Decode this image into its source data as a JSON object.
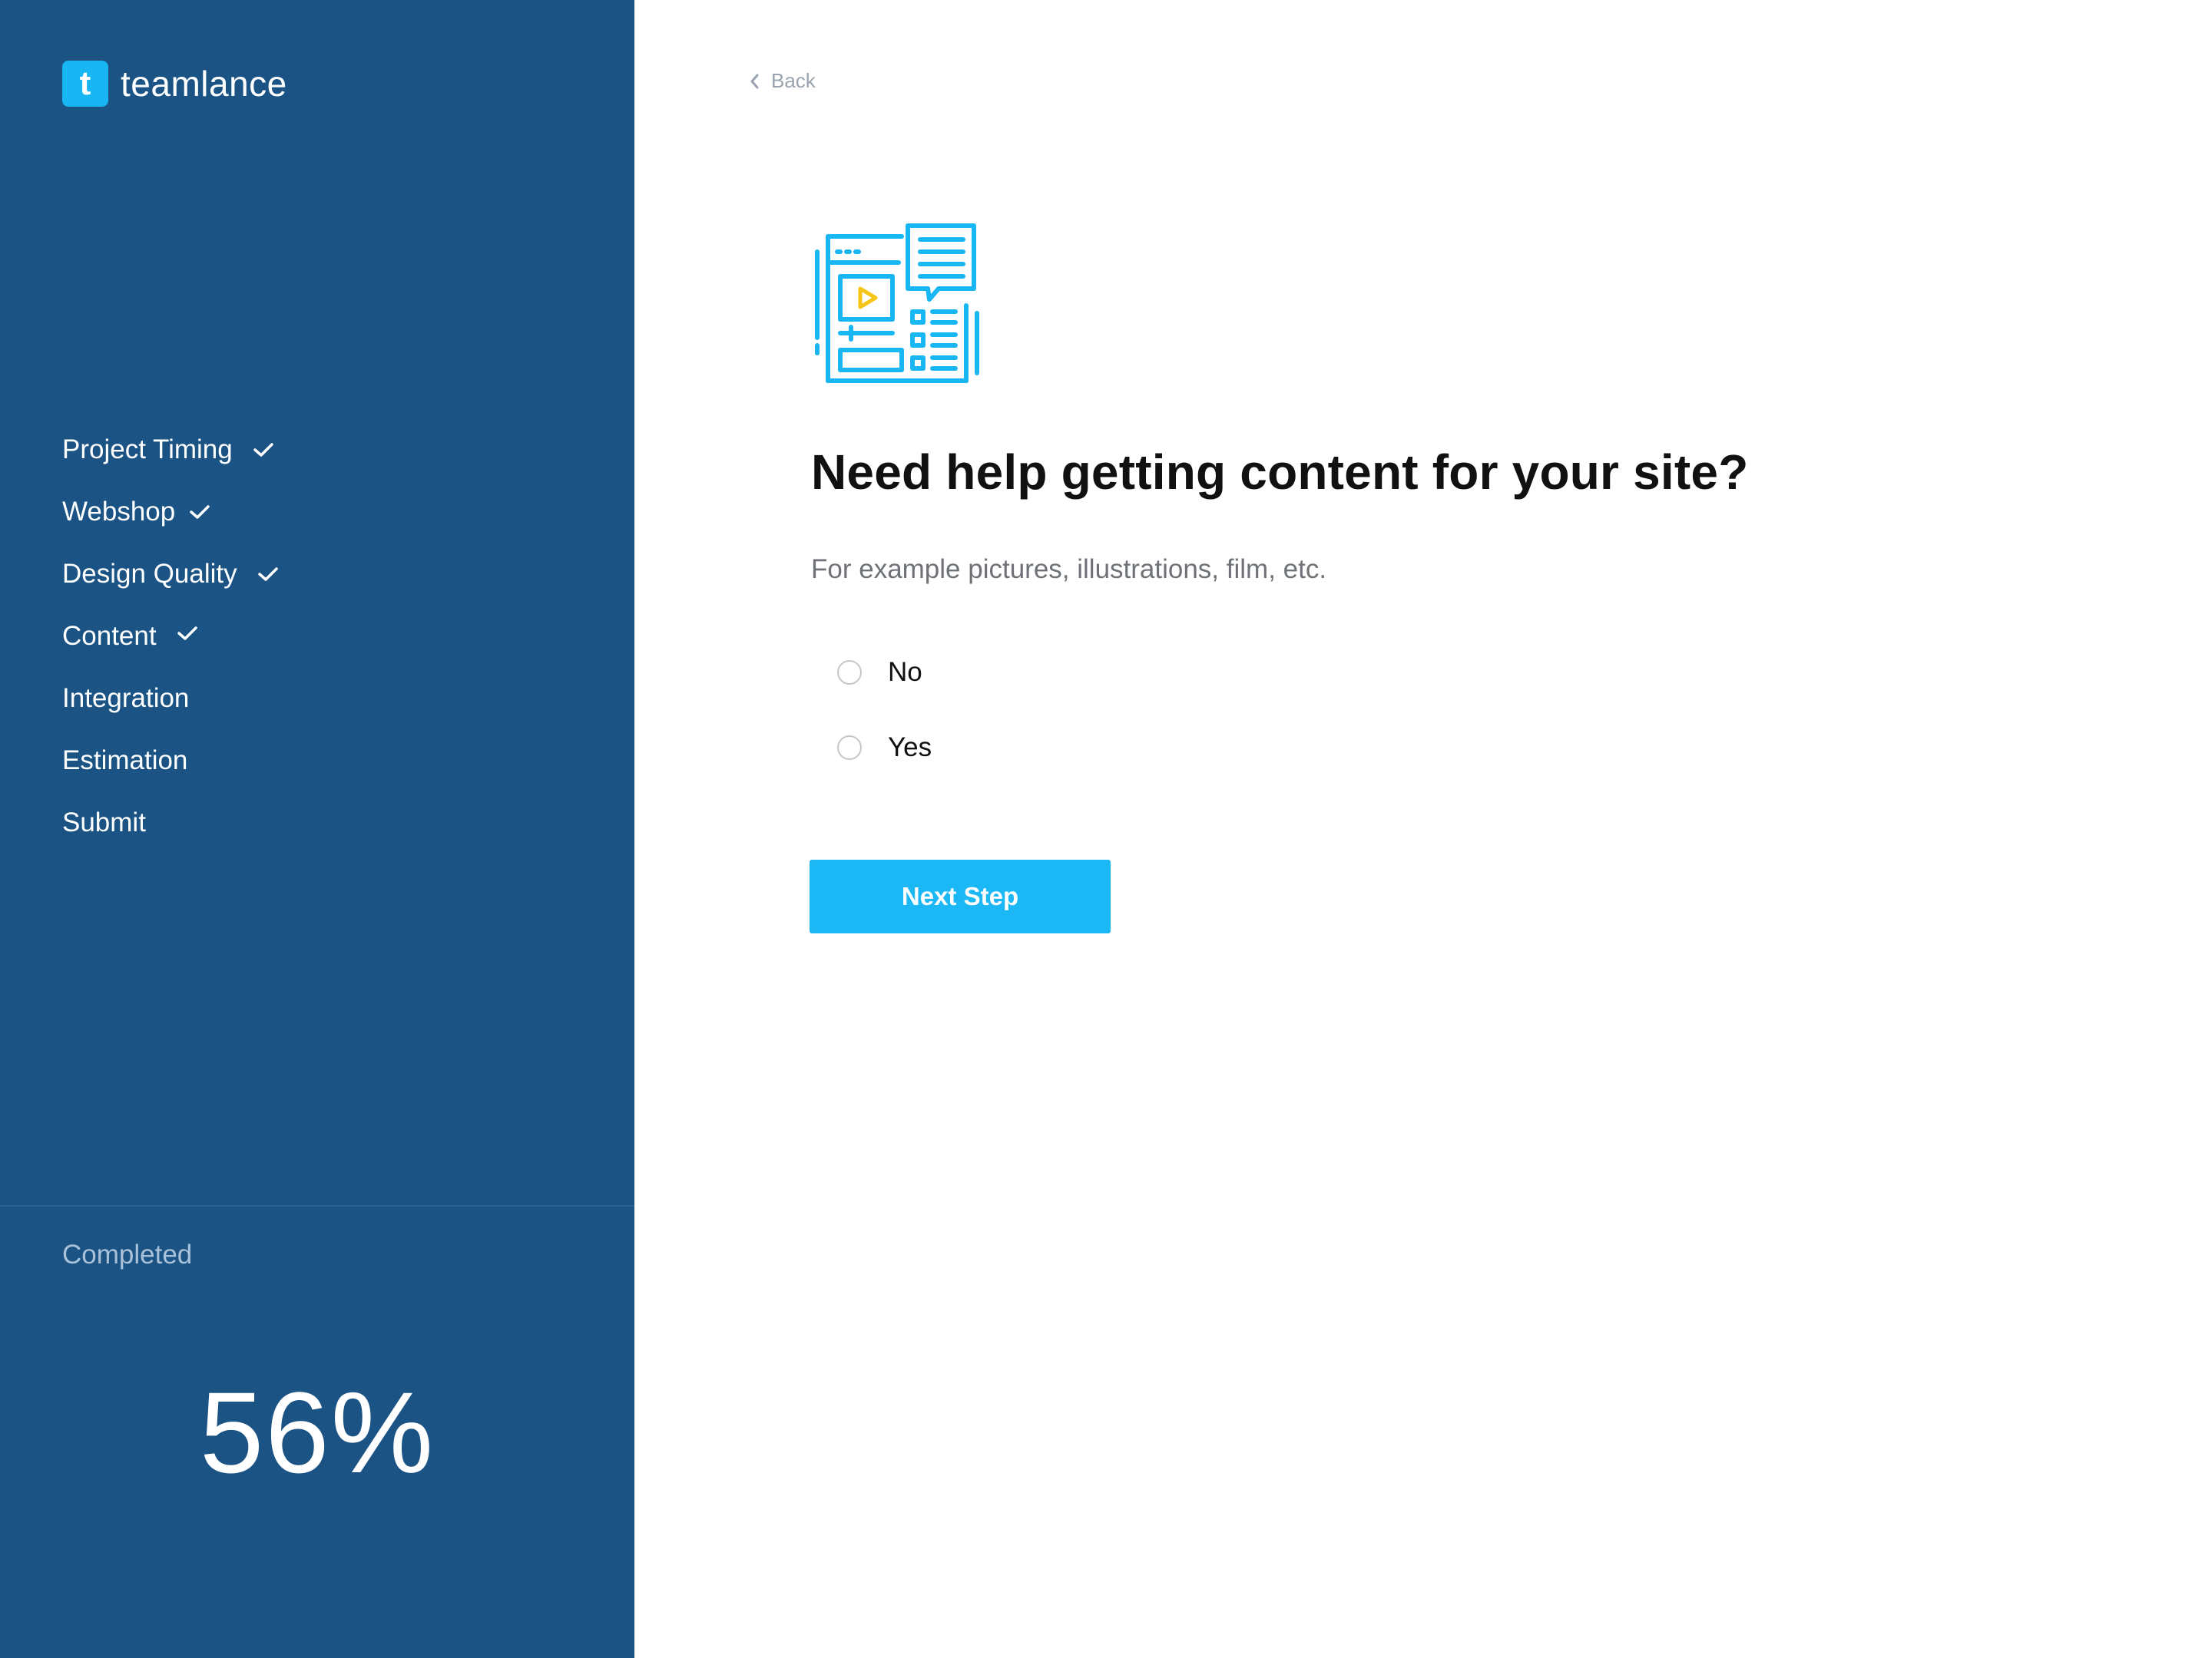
{
  "brand": {
    "logo_letter": "t",
    "name": "teamlance",
    "color": "#19b6f4"
  },
  "sidebar": {
    "background": "#1a5384",
    "steps": [
      {
        "label": "Project Timing",
        "completed": true
      },
      {
        "label": "Webshop",
        "completed": true
      },
      {
        "label": "Design Quality",
        "completed": true
      },
      {
        "label": "Content",
        "completed": true
      },
      {
        "label": "Integration",
        "completed": false
      },
      {
        "label": "Estimation",
        "completed": false
      },
      {
        "label": "Submit",
        "completed": false
      }
    ],
    "completed_label": "Completed",
    "completed_percent": "56%"
  },
  "main": {
    "back_label": "Back",
    "illustration_icon": "content-media-icon",
    "question": "Need help getting content for your site?",
    "subtitle": "For example pictures, illustrations, film, etc.",
    "options": [
      {
        "label": "No",
        "selected": false
      },
      {
        "label": "Yes",
        "selected": false
      }
    ],
    "next_button_label": "Next Step",
    "accent": "#1bb8f5"
  }
}
